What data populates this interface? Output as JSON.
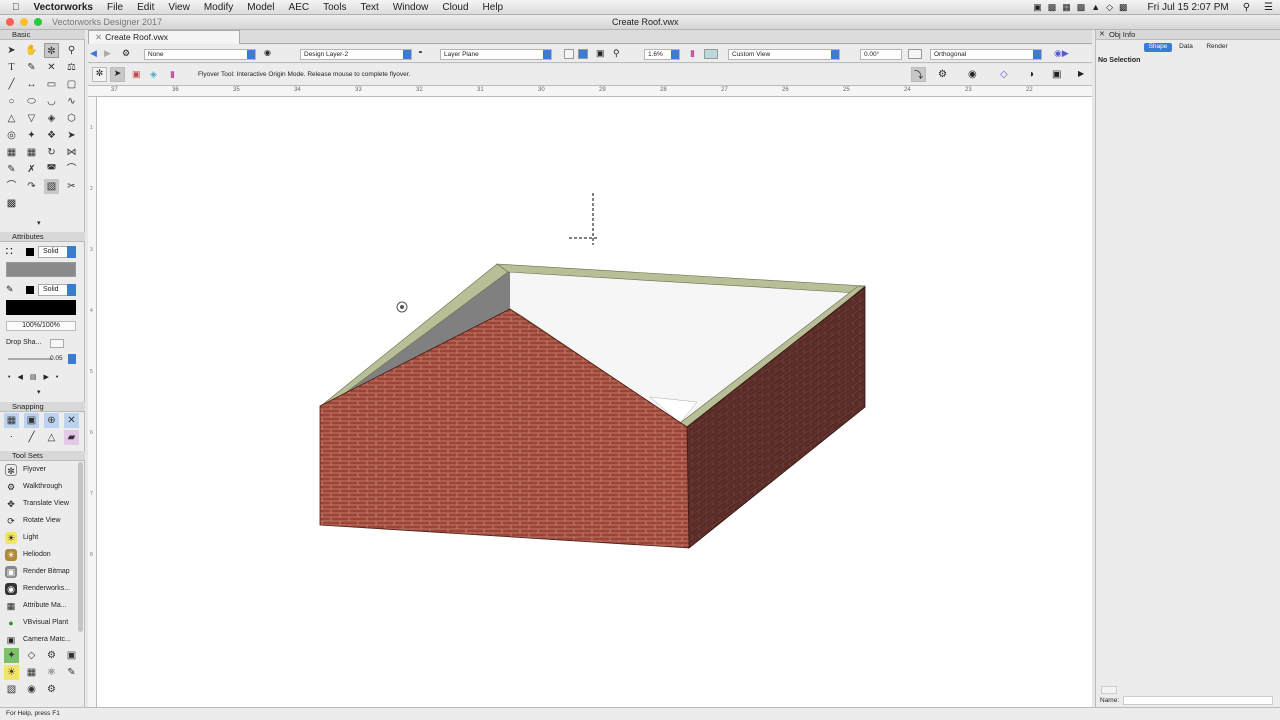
{
  "menubar": {
    "app": "Vectorworks",
    "items": [
      "File",
      "Edit",
      "View",
      "Modify",
      "Model",
      "AEC",
      "Tools",
      "Text",
      "Window",
      "Cloud",
      "Help"
    ],
    "clock": "Fri Jul 15  2:07 PM"
  },
  "window": {
    "app_title": "Vectorworks Designer 2017",
    "doc_title": "Create Roof.vwx",
    "tab_label": "Create Roof.vwx"
  },
  "viewbar": {
    "class": "None",
    "layer": "Design Layer-2",
    "plane": "Layer Plane",
    "zoom": "1.6%",
    "view": "Custom View",
    "angle": "0.00°",
    "projection": "Orthogonal"
  },
  "modebar": {
    "hint": "Flyover Tool: Interactive Origin Mode. Release mouse to complete flyover."
  },
  "ruler": {
    "ticks": [
      "37",
      "36",
      "35",
      "34",
      "33",
      "32",
      "31",
      "30",
      "29",
      "28",
      "27",
      "26",
      "25",
      "24",
      "23",
      "22"
    ]
  },
  "vruler": {
    "ticks": [
      "1",
      "2",
      "3",
      "4",
      "5",
      "6",
      "7",
      "8"
    ]
  },
  "basic": {
    "title": "Basic"
  },
  "attributes": {
    "title": "Attributes",
    "fill_style": "Solid",
    "pen_style": "Solid",
    "opacity": "100%/100%",
    "drop_shadow": "Drop Sha...",
    "line_weight": "0.05",
    "fill_color": "#8a8a8a",
    "pen_color": "#000000"
  },
  "snapping": {
    "title": "Snapping"
  },
  "toolsets": {
    "title": "Tool Sets",
    "items": [
      {
        "label": "Flyover",
        "icon": "flyover-icon"
      },
      {
        "label": "Walkthrough",
        "icon": "walkthrough-icon"
      },
      {
        "label": "Translate View",
        "icon": "translate-view-icon"
      },
      {
        "label": "Rotate View",
        "icon": "rotate-view-icon"
      },
      {
        "label": "Light",
        "icon": "light-icon"
      },
      {
        "label": "Heliodon",
        "icon": "heliodon-icon"
      },
      {
        "label": "Render Bitmap",
        "icon": "render-bitmap-icon"
      },
      {
        "label": "Renderworks...",
        "icon": "renderworks-icon"
      },
      {
        "label": "Attribute Ma...",
        "icon": "attribute-mapping-icon"
      },
      {
        "label": "VBvisual Plant",
        "icon": "plant-icon"
      },
      {
        "label": "Camera Matc...",
        "icon": "camera-match-icon"
      }
    ]
  },
  "objinfo": {
    "title": "Obj Info",
    "tabs": [
      "Shape",
      "Data",
      "Render"
    ],
    "active_tab": "Shape",
    "selection": "No Selection",
    "name_label": "Name:",
    "name_value": ""
  },
  "status": {
    "text": "For Help, press F1"
  },
  "colors": {
    "brick": "#9c4436",
    "roof_trim": "#b8bf96",
    "accent": "#3a7bd5"
  }
}
